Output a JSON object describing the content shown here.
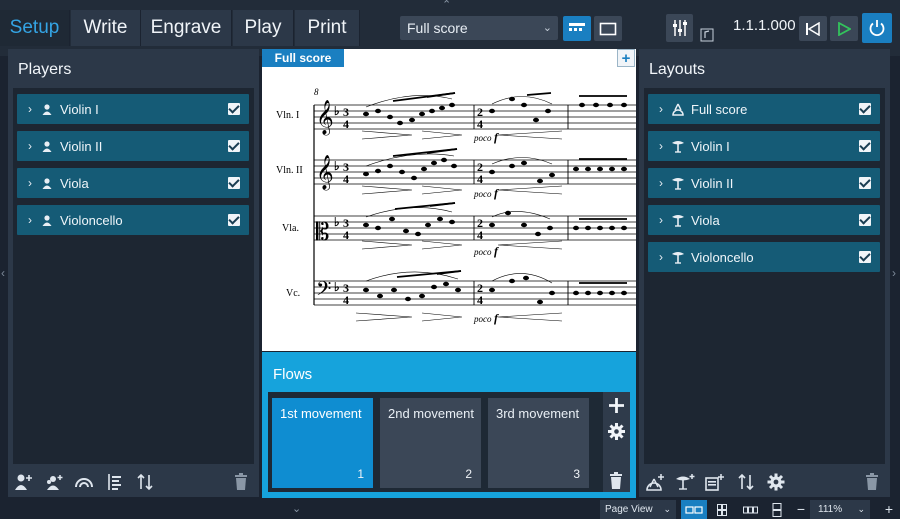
{
  "modes": [
    {
      "label": "Setup",
      "active": true
    },
    {
      "label": "Write",
      "active": false
    },
    {
      "label": "Engrave",
      "active": false
    },
    {
      "label": "Play",
      "active": false
    },
    {
      "label": "Print",
      "active": false
    }
  ],
  "toolbar": {
    "layout_selector": "Full score",
    "timecode": "1.1.1.000"
  },
  "players": {
    "title": "Players",
    "items": [
      {
        "label": "Violin I",
        "checked": true
      },
      {
        "label": "Violin II",
        "checked": true
      },
      {
        "label": "Viola",
        "checked": true
      },
      {
        "label": "Violoncello",
        "checked": true
      }
    ]
  },
  "layouts": {
    "title": "Layouts",
    "items": [
      {
        "label": "Full score",
        "checked": true,
        "icon": "full-score-icon"
      },
      {
        "label": "Violin I",
        "checked": true,
        "icon": "part-layout-icon"
      },
      {
        "label": "Violin II",
        "checked": true,
        "icon": "part-layout-icon"
      },
      {
        "label": "Viola",
        "checked": true,
        "icon": "part-layout-icon"
      },
      {
        "label": "Violoncello",
        "checked": true,
        "icon": "part-layout-icon"
      }
    ]
  },
  "score": {
    "tab_label": "Full score",
    "bar_number": "8",
    "staves": [
      {
        "label": "Vln. I"
      },
      {
        "label": "Vln. II"
      },
      {
        "label": "Vla."
      },
      {
        "label": "Vc."
      }
    ],
    "dynamic_word": "poco",
    "dynamic_mark": "f"
  },
  "flows": {
    "title": "Flows",
    "items": [
      {
        "name": "1st movement",
        "number": "1",
        "active": true
      },
      {
        "name": "2nd movement",
        "number": "2",
        "active": false
      },
      {
        "name": "3rd movement",
        "number": "3",
        "active": false
      }
    ]
  },
  "status": {
    "view": "Page View",
    "zoom": "111%"
  },
  "colors": {
    "accent": "#16a3dc",
    "row": "#155b76",
    "active_tab_text": "#34a4e4"
  }
}
